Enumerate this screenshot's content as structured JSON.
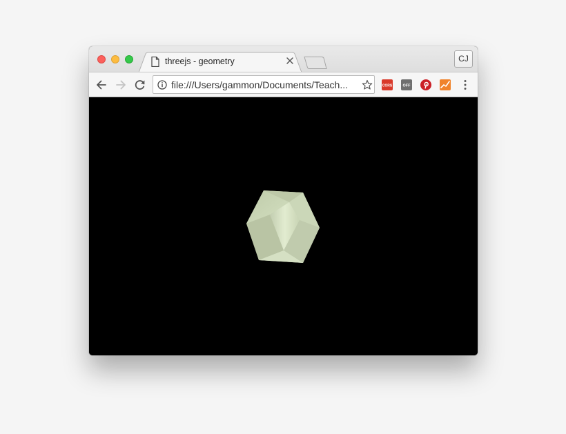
{
  "tab": {
    "title": "threejs - geometry",
    "page_icon": "document-icon",
    "close_icon": "close-icon"
  },
  "window_controls": [
    "close",
    "minimize",
    "zoom"
  ],
  "profile": {
    "initials": "CJ"
  },
  "toolbar": {
    "back_icon": "back-arrow-icon",
    "forward_icon": "forward-arrow-icon",
    "reload_icon": "reload-icon",
    "url": "file:///Users/gammon/Documents/Teach...",
    "info_icon": "info-icon",
    "bookmark_icon": "star-icon",
    "extensions": [
      {
        "name": "cors-extension-icon",
        "label": "CORS",
        "color": "#d93a2b"
      },
      {
        "name": "off-extension-icon",
        "label": "OFF",
        "color": "#6f6f6f"
      },
      {
        "name": "pinterest-icon",
        "color": "#cb2027"
      },
      {
        "name": "analytics-icon",
        "color": "#f0832a"
      }
    ],
    "menu_icon": "more-vert-icon"
  },
  "canvas": {
    "background": "#000000",
    "object": "icosahedron",
    "object_color": "#cfdcbc"
  }
}
